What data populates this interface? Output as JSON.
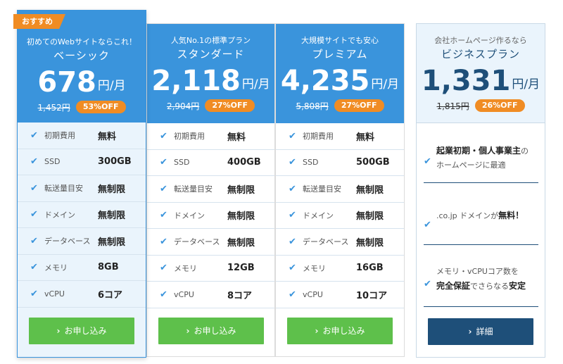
{
  "plans": [
    {
      "ribbon": "おすすめ",
      "tagline": "初めてのWebサイトならこれ！",
      "name": "ベーシック",
      "price": "678",
      "unit": "円/月",
      "old_price": "1,452円",
      "discount": "53%OFF",
      "features": [
        {
          "label": "初期費用",
          "value": "無料"
        },
        {
          "label": "SSD",
          "value": "300GB"
        },
        {
          "label": "転送量目安",
          "value": "無制限"
        },
        {
          "label": "ドメイン",
          "value": "無制限"
        },
        {
          "label": "データベース",
          "value": "無制限"
        },
        {
          "label": "メモリ",
          "value": "8GB"
        },
        {
          "label": "vCPU",
          "value": "6コア"
        }
      ],
      "button": "お申し込み"
    },
    {
      "tagline": "人気No.1の標準プラン",
      "name": "スタンダード",
      "price": "2,118",
      "unit": "円/月",
      "old_price": "2,904円",
      "discount": "27%OFF",
      "features": [
        {
          "label": "初期費用",
          "value": "無料"
        },
        {
          "label": "SSD",
          "value": "400GB"
        },
        {
          "label": "転送量目安",
          "value": "無制限"
        },
        {
          "label": "ドメイン",
          "value": "無制限"
        },
        {
          "label": "データベース",
          "value": "無制限"
        },
        {
          "label": "メモリ",
          "value": "12GB"
        },
        {
          "label": "vCPU",
          "value": "8コア"
        }
      ],
      "button": "お申し込み"
    },
    {
      "tagline": "大規模サイトでも安心",
      "name": "プレミアム",
      "price": "4,235",
      "unit": "円/月",
      "old_price": "5,808円",
      "discount": "27%OFF",
      "features": [
        {
          "label": "初期費用",
          "value": "無料"
        },
        {
          "label": "SSD",
          "value": "500GB"
        },
        {
          "label": "転送量目安",
          "value": "無制限"
        },
        {
          "label": "ドメイン",
          "value": "無制限"
        },
        {
          "label": "データベース",
          "value": "無制限"
        },
        {
          "label": "メモリ",
          "value": "16GB"
        },
        {
          "label": "vCPU",
          "value": "10コア"
        }
      ],
      "button": "お申し込み"
    }
  ],
  "business": {
    "tagline": "会社ホームページ作るなら",
    "name": "ビジネスプラン",
    "price": "1,331",
    "unit": "円/月",
    "old_price": "1,815円",
    "discount": "26%OFF",
    "f1_bold": "起業初期・個人事業主",
    "f1_suffix": "の",
    "f1_line2": "ホームページに最適",
    "f2_prefix": ".co.jp ドメインが",
    "f2_bold": "無料！",
    "f3_line1": "メモリ・vCPUコア数を",
    "f3_bold1": "完全保証",
    "f3_mid": "でさらなる",
    "f3_bold2": "安定",
    "button": "詳細"
  },
  "icons": {
    "check": "check-icon",
    "chevron": "chevron-right-icon"
  },
  "colors": {
    "accent_blue": "#3a94dc",
    "navy": "#1e4f79",
    "orange": "#f08c24",
    "green": "#5ec04b"
  }
}
